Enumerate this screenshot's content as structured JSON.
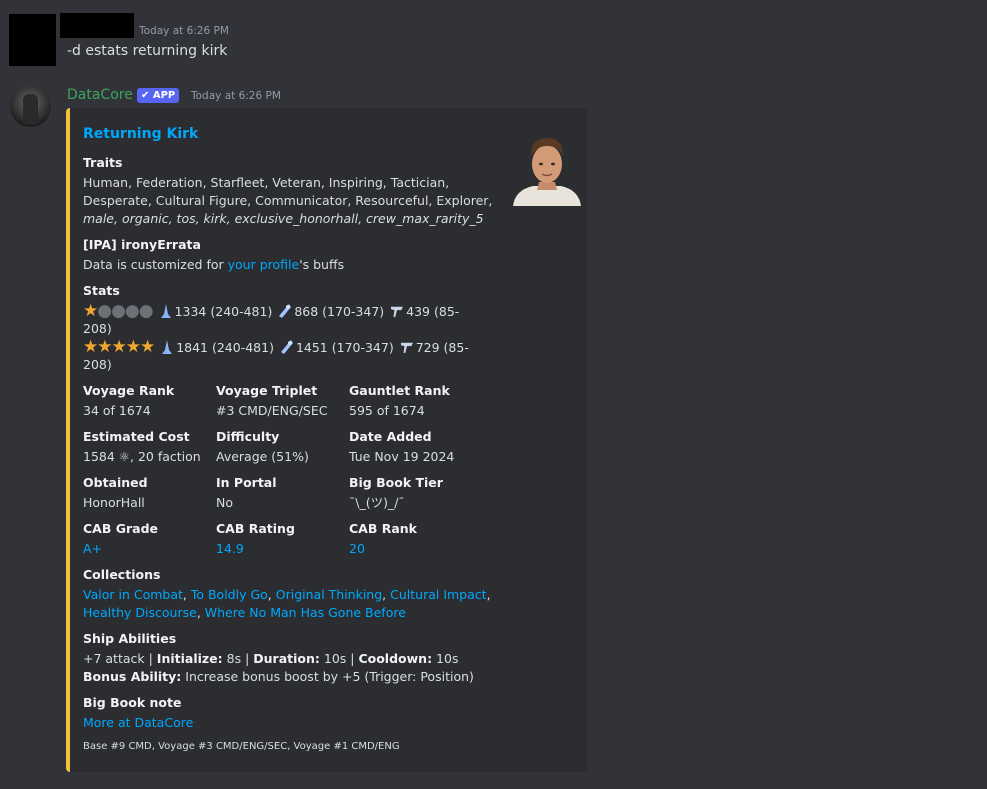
{
  "message1": {
    "timestamp": "Today at 6:26 PM",
    "text": "-d estats returning kirk"
  },
  "message2": {
    "author": "DataCore",
    "badge": "✔ APP",
    "timestamp": "Today at 6:26 PM",
    "embed": {
      "accent_color": "#f0c23b",
      "title": "Returning Kirk",
      "traits_label": "Traits",
      "traits_line1": "Human, Federation, Starfleet, Veteran, Inspiring, Tactician,",
      "traits_line2": "Desperate, Cultural Figure, Communicator, Resourceful, Explorer,",
      "traits_line3": "male, organic, tos, kirk, exclusive_honorhall, crew_max_rarity_5",
      "profile_label": "[IPA] ironyErrata",
      "profile_prefix": "Data is customized for ",
      "profile_link": "your profile",
      "profile_suffix": "'s buffs",
      "stats_label": "Stats",
      "stats_row1": {
        "filled_stars": 1,
        "empty_stars": 4,
        "cmd": "1334 (240-481)",
        "eng": "868 (170-347)",
        "sec_a": "439 (85-",
        "sec_b": "208)"
      },
      "stats_row2": {
        "filled_stars": 5,
        "empty_stars": 0,
        "cmd": "1841 (240-481)",
        "eng": "1451 (170-347)",
        "sec_a": "729 (85-",
        "sec_b": "208)"
      },
      "fields": [
        {
          "name": "Voyage Rank",
          "value": "34 of 1674"
        },
        {
          "name": "Voyage Triplet",
          "value": "#3 CMD/ENG/SEC"
        },
        {
          "name": "Gauntlet Rank",
          "value": "595 of 1674"
        },
        {
          "name": "Estimated Cost",
          "value": "1584 ⚛, 20 faction"
        },
        {
          "name": "Difficulty",
          "value": "Average (51%)"
        },
        {
          "name": "Date Added",
          "value": "Tue Nov 19 2024"
        },
        {
          "name": "Obtained",
          "value": "HonorHall"
        },
        {
          "name": "In Portal",
          "value": "No"
        },
        {
          "name": "Big Book Tier",
          "value": "¯\\_(ツ)_/¯"
        },
        {
          "name": "CAB Grade",
          "value": "A+"
        },
        {
          "name": "CAB Rating",
          "value": "14.9"
        },
        {
          "name": "CAB Rank",
          "value": "20"
        }
      ],
      "collections_label": "Collections",
      "collections": [
        "Valor in Combat",
        "To Boldly Go",
        "Original Thinking",
        "Cultural Impact",
        "Healthy Discourse",
        "Where No Man Has Gone Before"
      ],
      "ship_label": "Ship Abilities",
      "ship_attack": "+7 attack | ",
      "ship_init_label": "Initialize:",
      "ship_init_value": " 8s | ",
      "ship_dur_label": "Duration:",
      "ship_dur_value": " 10s | ",
      "ship_cd_label": "Cooldown:",
      "ship_cd_value": " 10s",
      "bonus_label": "Bonus Ability:",
      "bonus_value": " Increase bonus boost by +5 (Trigger: Position)",
      "bigbook_label": "Big Book note",
      "bigbook_link": "More at DataCore",
      "footer": "Base #9 CMD, Voyage #3 CMD/ENG/SEC, Voyage #1 CMD/ENG"
    }
  }
}
